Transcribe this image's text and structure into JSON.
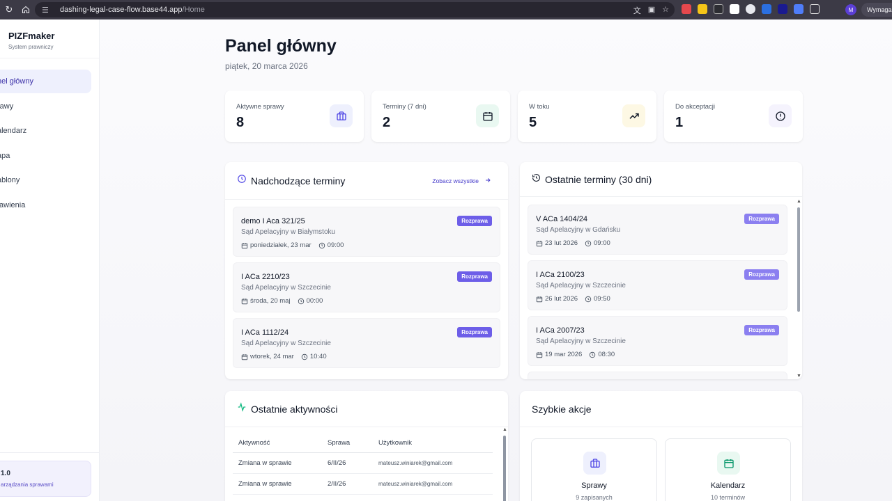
{
  "browser": {
    "url_host": "dashing-legal-case-flow.base44.app",
    "url_path": "/Home",
    "profile_initial": "M",
    "profile_label": "Wymagan"
  },
  "sidebar": {
    "brand": "PIZFmaker",
    "subtitle": "System prawniczy",
    "items": [
      {
        "label": "nel główny",
        "active": true
      },
      {
        "label": "rawy",
        "active": false
      },
      {
        "label": "alendarz",
        "active": false
      },
      {
        "label": "apa",
        "active": false
      },
      {
        "label": "ablony",
        "active": false
      },
      {
        "label": "tawienia",
        "active": false
      }
    ],
    "version": "1.0",
    "version_desc": "arządzania sprawami"
  },
  "header": {
    "title": "Panel główny",
    "date": "piątek, 20 marca 2026"
  },
  "stats": [
    {
      "label": "Aktywne sprawy",
      "value": "8",
      "icon": "briefcase-icon",
      "color": "#4f46e5",
      "bg": "#eef0fd"
    },
    {
      "label": "Terminy (7 dni)",
      "value": "2",
      "icon": "calendar-icon",
      "color": "#111827",
      "bg": "#e9f8f1"
    },
    {
      "label": "W toku",
      "value": "5",
      "icon": "trending-up-icon",
      "color": "#111827",
      "bg": "#fdf8e4"
    },
    {
      "label": "Do akceptacji",
      "value": "1",
      "icon": "alert-circle-icon",
      "color": "#111827",
      "bg": "#f5f3fd"
    }
  ],
  "upcoming": {
    "title": "Nadchodzące terminy",
    "see_all": "Zobacz wszystkie",
    "items": [
      {
        "signature": "demo I Aca 321/25",
        "court": "Sąd Apelacyjny w Białymstoku",
        "date": "poniedziałek, 23 mar",
        "time": "09:00",
        "badge": "Rozprawa"
      },
      {
        "signature": "I ACa 2210/23",
        "court": "Sąd Apelacyjny w Szczecinie",
        "date": "środa, 20 maj",
        "time": "00:00",
        "badge": "Rozprawa"
      },
      {
        "signature": "I ACa 1112/24",
        "court": "Sąd Apelacyjny w Szczecinie",
        "date": "wtorek, 24 mar",
        "time": "10:40",
        "badge": "Rozprawa"
      }
    ]
  },
  "recent": {
    "title": "Ostatnie terminy (30 dni)",
    "items": [
      {
        "signature": "V ACa 1404/24",
        "court": "Sąd Apelacyjny w Gdańsku",
        "date": "23 lut 2026",
        "time": "09:00",
        "badge": "Rozprawa"
      },
      {
        "signature": "I ACa 2100/23",
        "court": "Sąd Apelacyjny w Szczecinie",
        "date": "26 lut 2026",
        "time": "09:50",
        "badge": "Rozprawa"
      },
      {
        "signature": "I ACa 2007/23",
        "court": "Sąd Apelacyjny w Szczecinie",
        "date": "19 mar 2026",
        "time": "08:30",
        "badge": "Rozprawa"
      }
    ]
  },
  "activity": {
    "title": "Ostatnie aktywności",
    "columns": [
      "Aktywność",
      "Sprawa",
      "Użytkownik"
    ],
    "rows": [
      {
        "activity": "Zmiana w sprawie",
        "case": "6/II/26",
        "user": "mateusz.winiarek@gmail.com"
      },
      {
        "activity": "Zmiana w sprawie",
        "case": "2/II/26",
        "user": "mateusz.winiarek@gmail.com"
      }
    ]
  },
  "quick_actions": {
    "title": "Szybkie akcje",
    "items": [
      {
        "title": "Sprawy",
        "sub": "9 zapisanych",
        "icon": "briefcase-icon",
        "color": "#4f46e5",
        "bg": "#eef0fd"
      },
      {
        "title": "Kalendarz",
        "sub": "10 terminów",
        "icon": "calendar-icon",
        "color": "#059669",
        "bg": "#e9f8f1"
      }
    ]
  },
  "colors": {
    "accent": "#6d5ee8",
    "activity_green": "#10b981"
  }
}
